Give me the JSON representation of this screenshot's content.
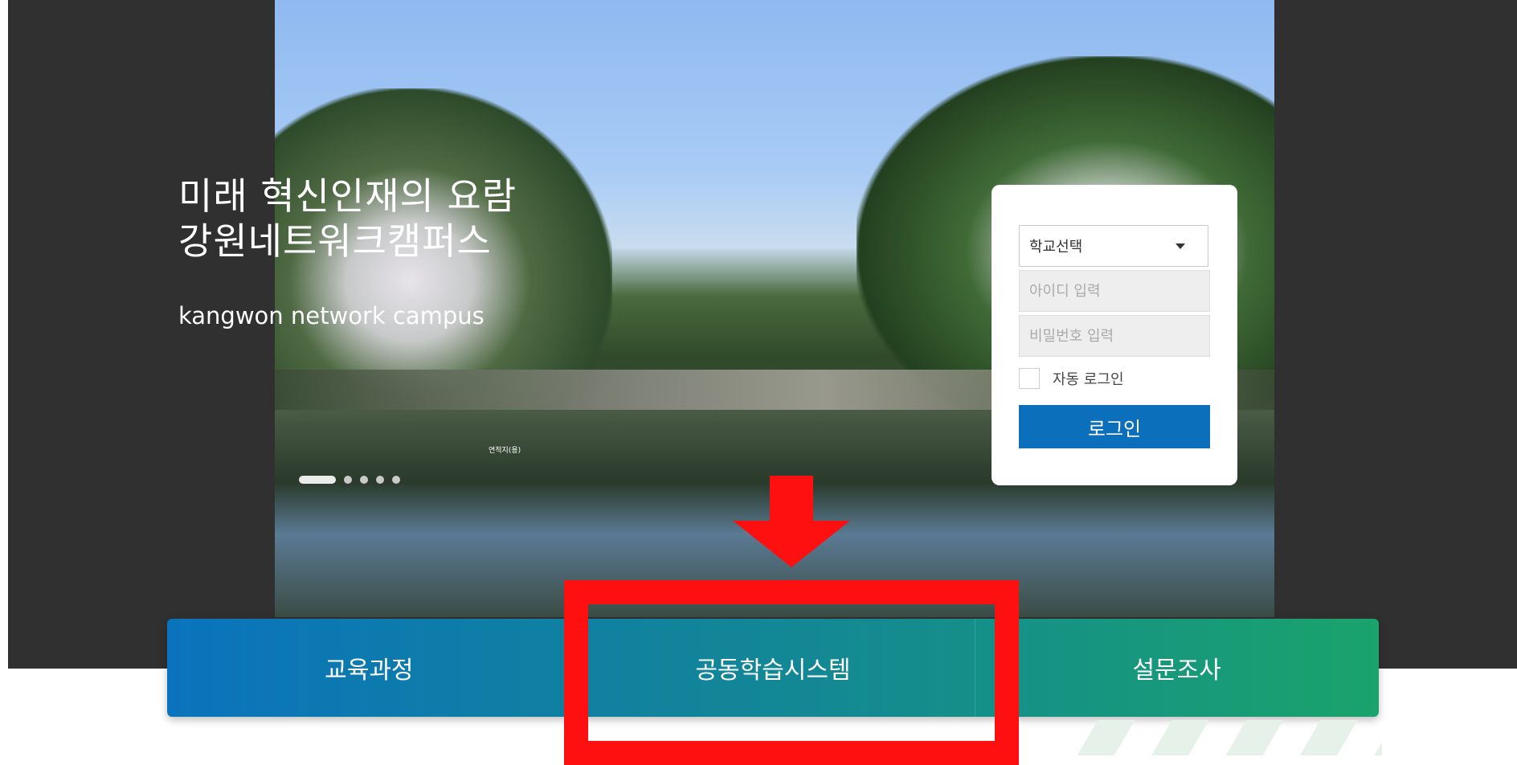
{
  "hero": {
    "slogan_line1": "미래 혁신인재의 요람",
    "slogan_line2": "강원네트워크캠퍼스",
    "subtitle": "kangwon network campus",
    "photo_caption": "연적지(용)",
    "slide_indicator": {
      "active_index": 0,
      "count": 5
    }
  },
  "login": {
    "school_select_label": "학교선택",
    "id_placeholder": "아이디 입력",
    "password_placeholder": "비밀번호 입력",
    "auto_login_label": "자동 로그인",
    "login_button_label": "로그인"
  },
  "menu": {
    "items": [
      {
        "label": "교육과정"
      },
      {
        "label": "공동학습시스템"
      },
      {
        "label": "설문조사"
      }
    ]
  },
  "annotation": {
    "color": "#ff1010",
    "highlighted_item": "공동학습시스템"
  },
  "colors": {
    "login_button": "#0c6fbb",
    "menu_gradient_start": "#0a73bd",
    "menu_gradient_end": "#1aa36c",
    "dark_band": "#303030"
  }
}
